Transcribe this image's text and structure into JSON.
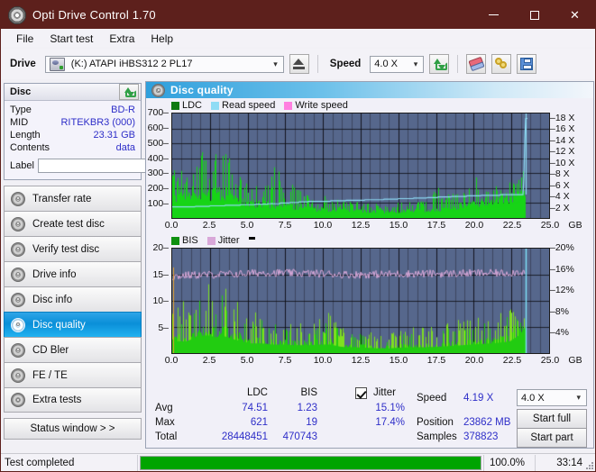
{
  "window": {
    "title": "Opti Drive Control 1.70",
    "icon": "disc-icon",
    "minimize": "—",
    "maximize": "□",
    "close": "✕"
  },
  "menu": [
    "File",
    "Start test",
    "Extra",
    "Help"
  ],
  "toolbar": {
    "drive_label": "Drive",
    "drive_value": "(K:)  ATAPI iHBS312  2 PL17",
    "eject_icon": "eject-icon",
    "speed_label": "Speed",
    "speed_value": "4.0 X",
    "refresh_icon": "refresh-icon",
    "eraser_icon": "eraser-icon",
    "chain_icon": "chain-icon",
    "save_icon": "save-icon"
  },
  "disc_panel": {
    "title": "Disc",
    "refresh_icon": "refresh-icon",
    "rows": [
      {
        "key": "Type",
        "value": "BD-R"
      },
      {
        "key": "MID",
        "value": "RITEKBR3 (000)"
      },
      {
        "key": "Length",
        "value": "23.31 GB"
      },
      {
        "key": "Contents",
        "value": "data"
      }
    ],
    "label_key": "Label",
    "label_value": "",
    "label_placeholder": "",
    "disc_icon": "cd-icon"
  },
  "nav": {
    "items": [
      {
        "label": "Transfer rate",
        "active": false
      },
      {
        "label": "Create test disc",
        "active": false
      },
      {
        "label": "Verify test disc",
        "active": false
      },
      {
        "label": "Drive info",
        "active": false
      },
      {
        "label": "Disc info",
        "active": false
      },
      {
        "label": "Disc quality",
        "active": true
      },
      {
        "label": "CD Bler",
        "active": false
      },
      {
        "label": "FE / TE",
        "active": false
      },
      {
        "label": "Extra tests",
        "active": false
      }
    ],
    "status_window": "Status window > >"
  },
  "content": {
    "header_title": "Disc quality",
    "header_icon": "cd-icon"
  },
  "stats": {
    "col_ldc": "LDC",
    "col_bis": "BIS",
    "jitter_label": "Jitter",
    "jitter_checked": true,
    "row_avg": "Avg",
    "row_max": "Max",
    "row_total": "Total",
    "avg_ldc": "74.51",
    "avg_bis": "1.23",
    "avg_jitter": "15.1%",
    "max_ldc": "621",
    "max_bis": "19",
    "max_jitter": "17.4%",
    "total_ldc": "28448451",
    "total_bis": "470743",
    "speed_label": "Speed",
    "speed_value": "4.19 X",
    "position_label": "Position",
    "position_value": "23862 MB",
    "samples_label": "Samples",
    "samples_value": "378823",
    "speed_select": "4.0 X",
    "start_full": "Start full",
    "start_part": "Start part"
  },
  "statusbar": {
    "text": "Test completed",
    "progress_pct": "100.0%",
    "progress_value": 100,
    "time": "33:14"
  },
  "colors": {
    "titlebar": "#5d201c",
    "accent_blue": "#2e2ec8",
    "plot_bg": "#56678c",
    "ldc_green": "#17d417",
    "bis_green": "#22cc11",
    "read_speed": "#8fdcf5",
    "write_speed": "#ff7fe0",
    "jitter_pink": "#d9a8d9",
    "progress_green": "#00a400",
    "nav_active": "#0a8fd8"
  },
  "chart_data": [
    {
      "type": "area",
      "name": "ldc-chart",
      "title": "",
      "xlabel": "GB",
      "ylabel": "",
      "ylim": [
        0,
        700
      ],
      "xlim": [
        0,
        25
      ],
      "y2lim": [
        0,
        18
      ],
      "y2label": "X",
      "grid": true,
      "legend": [
        "LDC",
        "Read speed",
        "Write speed"
      ],
      "legend_position": "top-left",
      "yticks": [
        100,
        200,
        300,
        400,
        500,
        600,
        700
      ],
      "y2ticks": [
        2,
        4,
        6,
        8,
        10,
        12,
        14,
        16,
        18
      ],
      "xticks": [
        0.0,
        2.5,
        5.0,
        7.5,
        10.0,
        12.5,
        15.0,
        17.5,
        20.0,
        22.5,
        25.0
      ],
      "xtick_labels": [
        "0.0",
        "2.5",
        "5.0",
        "7.5",
        "10.0",
        "12.5",
        "15.0",
        "17.5",
        "20.0",
        "22.5",
        "25.0"
      ],
      "series": [
        {
          "name": "LDC",
          "color": "#17d417",
          "kind": "area",
          "x_end": 23.4,
          "envelope": [
            {
              "x": 0.0,
              "base": 150,
              "peak": 340
            },
            {
              "x": 0.3,
              "base": 160,
              "peak": 300
            },
            {
              "x": 0.6,
              "base": 150,
              "peak": 320
            },
            {
              "x": 1.0,
              "base": 150,
              "peak": 300
            },
            {
              "x": 1.4,
              "base": 160,
              "peak": 330
            },
            {
              "x": 1.8,
              "base": 180,
              "peak": 420
            },
            {
              "x": 2.1,
              "base": 190,
              "peak": 500
            },
            {
              "x": 2.4,
              "base": 180,
              "peak": 430
            },
            {
              "x": 2.8,
              "base": 190,
              "peak": 420
            },
            {
              "x": 3.1,
              "base": 185,
              "peak": 490
            },
            {
              "x": 3.4,
              "base": 190,
              "peak": 500
            },
            {
              "x": 3.8,
              "base": 180,
              "peak": 480
            },
            {
              "x": 4.2,
              "base": 140,
              "peak": 300
            },
            {
              "x": 4.8,
              "base": 120,
              "peak": 250
            },
            {
              "x": 5.4,
              "base": 110,
              "peak": 230
            },
            {
              "x": 6.0,
              "base": 100,
              "peak": 200
            },
            {
              "x": 6.6,
              "base": 100,
              "peak": 300
            },
            {
              "x": 6.9,
              "base": 100,
              "peak": 430
            },
            {
              "x": 7.4,
              "base": 95,
              "peak": 190
            },
            {
              "x": 8.0,
              "base": 90,
              "peak": 230
            },
            {
              "x": 8.6,
              "base": 85,
              "peak": 170
            },
            {
              "x": 9.2,
              "base": 70,
              "peak": 140
            },
            {
              "x": 10.0,
              "base": 65,
              "peak": 150
            },
            {
              "x": 10.8,
              "base": 70,
              "peak": 140
            },
            {
              "x": 11.6,
              "base": 62,
              "peak": 120
            },
            {
              "x": 12.4,
              "base": 58,
              "peak": 110
            },
            {
              "x": 13.2,
              "base": 52,
              "peak": 100
            },
            {
              "x": 14.0,
              "base": 50,
              "peak": 95
            },
            {
              "x": 14.8,
              "base": 52,
              "peak": 100
            },
            {
              "x": 15.6,
              "base": 55,
              "peak": 110
            },
            {
              "x": 16.4,
              "base": 58,
              "peak": 120
            },
            {
              "x": 17.0,
              "base": 62,
              "peak": 130
            },
            {
              "x": 17.4,
              "base": 70,
              "peak": 370
            },
            {
              "x": 17.8,
              "base": 72,
              "peak": 150
            },
            {
              "x": 18.4,
              "base": 80,
              "peak": 160
            },
            {
              "x": 19.0,
              "base": 90,
              "peak": 175
            },
            {
              "x": 19.6,
              "base": 100,
              "peak": 190
            },
            {
              "x": 20.0,
              "base": 110,
              "peak": 340
            },
            {
              "x": 20.4,
              "base": 115,
              "peak": 205
            },
            {
              "x": 21.0,
              "base": 120,
              "peak": 210
            },
            {
              "x": 21.6,
              "base": 125,
              "peak": 215
            },
            {
              "x": 22.2,
              "base": 140,
              "peak": 230
            },
            {
              "x": 22.8,
              "base": 160,
              "peak": 260
            },
            {
              "x": 23.1,
              "base": 190,
              "peak": 300
            },
            {
              "x": 23.4,
              "base": 240,
              "peak": 340
            }
          ]
        },
        {
          "name": "Read speed",
          "color": "#8fdcf5",
          "kind": "line",
          "axis": "right",
          "points": [
            {
              "x": 0.0,
              "y": 1.95
            },
            {
              "x": 1.5,
              "y": 2.05
            },
            {
              "x": 3.0,
              "y": 2.2
            },
            {
              "x": 4.5,
              "y": 2.35
            },
            {
              "x": 6.0,
              "y": 2.5
            },
            {
              "x": 7.5,
              "y": 2.7
            },
            {
              "x": 9.0,
              "y": 2.95
            },
            {
              "x": 10.5,
              "y": 3.05
            },
            {
              "x": 12.0,
              "y": 3.2
            },
            {
              "x": 13.5,
              "y": 3.3
            },
            {
              "x": 15.0,
              "y": 3.45
            },
            {
              "x": 16.5,
              "y": 3.6
            },
            {
              "x": 18.0,
              "y": 3.8
            },
            {
              "x": 19.5,
              "y": 3.95
            },
            {
              "x": 21.0,
              "y": 4.1
            },
            {
              "x": 22.5,
              "y": 4.2
            },
            {
              "x": 23.3,
              "y": 4.25
            },
            {
              "x": 23.42,
              "y": 18.0
            }
          ]
        }
      ]
    },
    {
      "type": "area",
      "name": "bis-jitter-chart",
      "title": "",
      "xlabel": "GB",
      "ylabel": "",
      "ylim": [
        0,
        20
      ],
      "xlim": [
        0,
        25
      ],
      "y2lim": [
        0,
        20
      ],
      "y2label": "%",
      "grid": true,
      "legend": [
        "BIS",
        "Jitter"
      ],
      "legend_position": "top-left",
      "yticks": [
        5,
        10,
        15,
        20
      ],
      "y2ticks": [
        4,
        8,
        12,
        16,
        20
      ],
      "y2tick_labels": [
        "4%",
        "8%",
        "12%",
        "16%",
        "20%"
      ],
      "xticks": [
        0.0,
        2.5,
        5.0,
        7.5,
        10.0,
        12.5,
        15.0,
        17.5,
        20.0,
        22.5,
        25.0
      ],
      "xtick_labels": [
        "0.0",
        "2.5",
        "5.0",
        "7.5",
        "10.0",
        "12.5",
        "15.0",
        "17.5",
        "20.0",
        "22.5",
        "25.0"
      ],
      "series": [
        {
          "name": "BIS",
          "color": "#22cc11",
          "kind": "area",
          "x_end": 23.4,
          "envelope": [
            {
              "x": 0.0,
              "base": 3.5,
              "peak": 13.0
            },
            {
              "x": 0.4,
              "base": 3.0,
              "peak": 10.5
            },
            {
              "x": 0.9,
              "base": 3.0,
              "peak": 10.0
            },
            {
              "x": 1.3,
              "base": 3.5,
              "peak": 11.0
            },
            {
              "x": 1.7,
              "base": 4.5,
              "peak": 14.5
            },
            {
              "x": 2.1,
              "base": 4.5,
              "peak": 14.0
            },
            {
              "x": 2.5,
              "base": 4.5,
              "peak": 13.0
            },
            {
              "x": 2.9,
              "base": 4.0,
              "peak": 12.5
            },
            {
              "x": 3.3,
              "base": 4.5,
              "peak": 14.0
            },
            {
              "x": 3.7,
              "base": 4.0,
              "peak": 12.0
            },
            {
              "x": 4.1,
              "base": 3.5,
              "peak": 11.0
            },
            {
              "x": 4.6,
              "base": 3.0,
              "peak": 9.0
            },
            {
              "x": 5.2,
              "base": 2.5,
              "peak": 8.0
            },
            {
              "x": 5.9,
              "base": 2.5,
              "peak": 8.5
            },
            {
              "x": 6.6,
              "base": 2.2,
              "peak": 6.5
            },
            {
              "x": 7.4,
              "base": 2.2,
              "peak": 7.0
            },
            {
              "x": 8.2,
              "base": 2.0,
              "peak": 6.5
            },
            {
              "x": 9.0,
              "base": 2.0,
              "peak": 6.0
            },
            {
              "x": 9.8,
              "base": 2.2,
              "peak": 7.0
            },
            {
              "x": 10.5,
              "base": 2.2,
              "peak": 8.0
            },
            {
              "x": 11.2,
              "base": 1.6,
              "peak": 5.0
            },
            {
              "x": 12.0,
              "base": 1.5,
              "peak": 4.5
            },
            {
              "x": 12.8,
              "base": 1.4,
              "peak": 4.5
            },
            {
              "x": 13.6,
              "base": 1.2,
              "peak": 4.0
            },
            {
              "x": 14.4,
              "base": 1.2,
              "peak": 4.0
            },
            {
              "x": 15.2,
              "base": 1.4,
              "peak": 5.0
            },
            {
              "x": 16.0,
              "base": 1.5,
              "peak": 5.5
            },
            {
              "x": 16.8,
              "base": 1.5,
              "peak": 5.0
            },
            {
              "x": 17.6,
              "base": 1.6,
              "peak": 5.5
            },
            {
              "x": 18.4,
              "base": 1.8,
              "peak": 6.0
            },
            {
              "x": 19.2,
              "base": 2.0,
              "peak": 6.5
            },
            {
              "x": 20.0,
              "base": 2.2,
              "peak": 7.0
            },
            {
              "x": 20.8,
              "base": 2.4,
              "peak": 7.5
            },
            {
              "x": 21.6,
              "base": 2.6,
              "peak": 8.0
            },
            {
              "x": 22.4,
              "base": 3.0,
              "peak": 8.5
            },
            {
              "x": 23.0,
              "base": 4.5,
              "peak": 8.0
            },
            {
              "x": 23.4,
              "base": 6.5,
              "peak": 7.5
            }
          ]
        },
        {
          "name": "Jitter",
          "color": "#d9a8d9",
          "kind": "line-noisy",
          "noise": 0.75,
          "points": [
            {
              "x": 0.0,
              "y": 14.6
            },
            {
              "x": 1.0,
              "y": 14.9
            },
            {
              "x": 2.5,
              "y": 15.0
            },
            {
              "x": 4.0,
              "y": 15.1
            },
            {
              "x": 6.0,
              "y": 15.4
            },
            {
              "x": 8.0,
              "y": 15.3
            },
            {
              "x": 10.0,
              "y": 15.2
            },
            {
              "x": 12.0,
              "y": 15.0
            },
            {
              "x": 14.0,
              "y": 15.1
            },
            {
              "x": 16.0,
              "y": 15.2
            },
            {
              "x": 18.0,
              "y": 15.2
            },
            {
              "x": 20.0,
              "y": 15.3
            },
            {
              "x": 22.0,
              "y": 15.3
            },
            {
              "x": 23.4,
              "y": 15.6
            }
          ]
        }
      ]
    }
  ]
}
